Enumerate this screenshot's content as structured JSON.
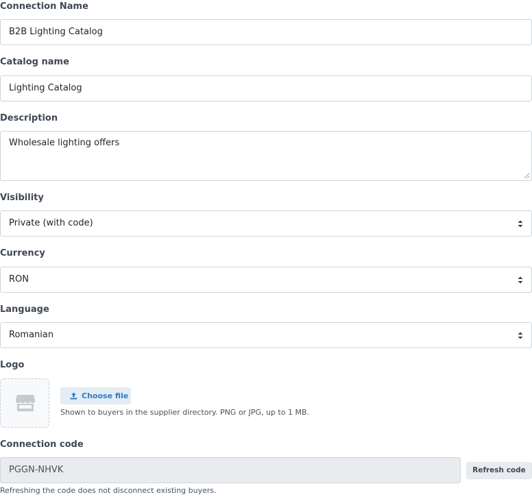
{
  "connection_name": {
    "label": "Connection Name",
    "value": "B2B Lighting Catalog"
  },
  "catalog_name": {
    "label": "Catalog name",
    "value": "Lighting Catalog"
  },
  "description": {
    "label": "Description",
    "value": "Wholesale lighting offers"
  },
  "visibility": {
    "label": "Visibility",
    "value": "Private (with code)"
  },
  "currency": {
    "label": "Currency",
    "value": "RON"
  },
  "language": {
    "label": "Language",
    "value": "Romanian"
  },
  "logo": {
    "label": "Logo",
    "placeholder_icon": "storefront-icon",
    "choose_button": "Choose file",
    "choose_icon": "upload-icon",
    "hint": "Shown to buyers in the supplier directory. PNG or JPG, up to 1 MB."
  },
  "connection_code": {
    "label": "Connection code",
    "value": "PGGN-NHVK",
    "refresh_button": "Refresh code",
    "hint": "Refreshing the code does not disconnect existing buyers."
  },
  "colors": {
    "label_text": "#3f4854",
    "border": "#ced4da",
    "readonly_bg": "#e9ecef",
    "accent": "#2f7cc0",
    "accent_bg": "#e4edf5"
  }
}
